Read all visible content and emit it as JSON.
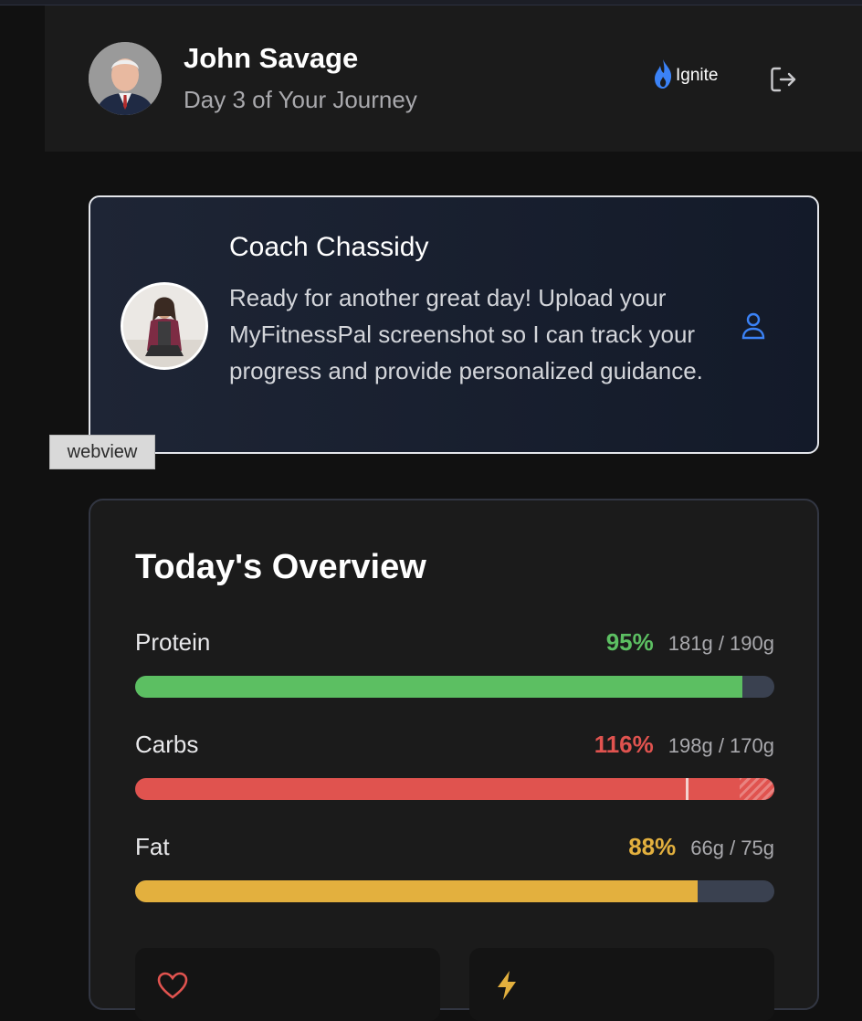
{
  "header": {
    "user_name": "John Savage",
    "user_subtitle": "Day 3 of Your Journey",
    "brand_name": "Ignite",
    "brand_icon": "flame-icon",
    "logout_icon": "logout-icon",
    "brand_color": "#3b82f6"
  },
  "coach": {
    "name": "Coach Chassidy",
    "message": "Ready for another great day! Upload your MyFitnessPal screenshot so I can track your progress and provide personalized guidance.",
    "action_icon": "person-icon"
  },
  "debug_tag": "webview",
  "overview": {
    "title": "Today's Overview",
    "macros": [
      {
        "label": "Protein",
        "percent_text": "95%",
        "amount": "181g / 190g",
        "percent": 95,
        "color": "#5cbf62"
      },
      {
        "label": "Carbs",
        "percent_text": "116%",
        "amount": "198g / 170g",
        "percent": 116,
        "color": "#e0534f"
      },
      {
        "label": "Fat",
        "percent_text": "88%",
        "amount": "66g / 75g",
        "percent": 88,
        "color": "#e3b03e"
      }
    ],
    "mini_cards": [
      {
        "icon": "heart-icon"
      },
      {
        "icon": "bolt-icon"
      }
    ]
  }
}
